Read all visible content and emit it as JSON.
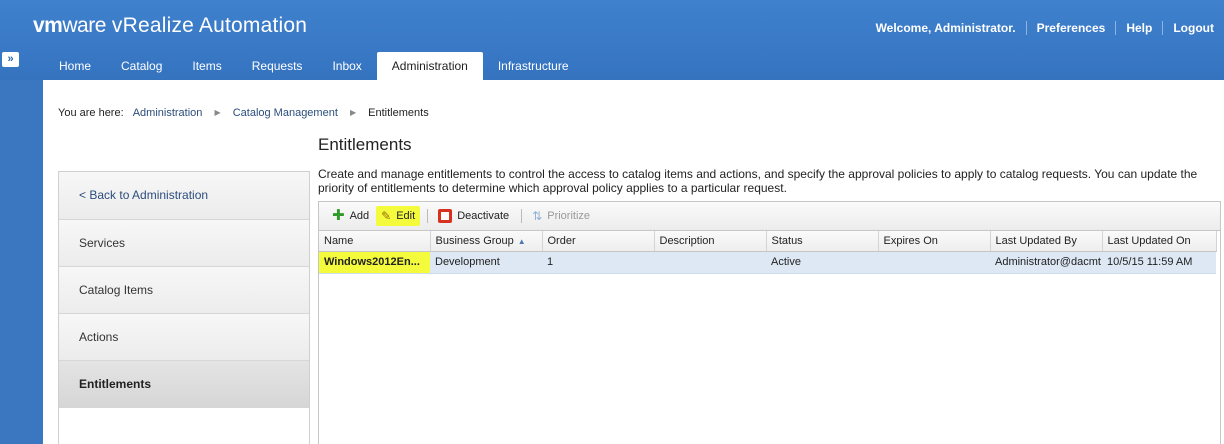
{
  "header": {
    "logo_vm": "vm",
    "logo_ware": "ware",
    "product": "vRealize Automation",
    "welcome": "Welcome, Administrator.",
    "links": [
      "Preferences",
      "Help",
      "Logout"
    ],
    "side_toggle": "»"
  },
  "nav": {
    "tabs": [
      "Home",
      "Catalog",
      "Items",
      "Requests",
      "Inbox",
      "Administration",
      "Infrastructure"
    ],
    "active": "Administration"
  },
  "breadcrumb": {
    "prefix": "You are here:",
    "items": [
      "Administration",
      "Catalog Management",
      "Entitlements"
    ],
    "separator": "▶"
  },
  "leftnav": {
    "items": [
      "< Back to Administration",
      "Services",
      "Catalog Items",
      "Actions",
      "Entitlements"
    ],
    "selected": "Entitlements"
  },
  "page": {
    "title": "Entitlements",
    "description": "Create and manage entitlements to control the access to catalog items and actions, and specify the approval policies to apply to catalog requests. You can update the priority of entitlements to determine which approval policy applies to a particular request."
  },
  "toolbar": {
    "add_label": "Add",
    "edit_label": "Edit",
    "deactivate_label": "Deactivate",
    "prioritize_label": "Prioritize"
  },
  "table": {
    "columns": [
      "Name",
      "Business Group",
      "Order",
      "Description",
      "Status",
      "Expires On",
      "Last Updated By",
      "Last Updated On"
    ],
    "sort_indicator": "▲",
    "rows": [
      {
        "name": "Windows2012En...",
        "business_group": "Development",
        "order": "1",
        "description": "",
        "status": "Active",
        "expires_on": "",
        "last_updated_by": "Administrator@dacmt",
        "last_updated_on": "10/5/15 11:59 AM"
      }
    ]
  },
  "colors": {
    "header_blue": "#3b77c0",
    "highlight": "#f4fa3c",
    "selected_row": "#dde8f4"
  }
}
